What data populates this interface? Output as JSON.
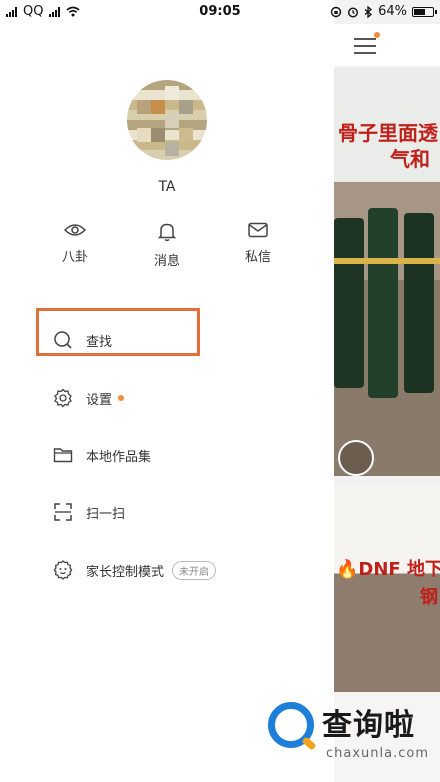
{
  "status_bar": {
    "carrier": "QQ",
    "time": "09:05",
    "battery": "64%",
    "battery_level": 0.64
  },
  "drawer": {
    "username": "TA",
    "actions": [
      {
        "label": "八卦",
        "icon": "eye-icon"
      },
      {
        "label": "消息",
        "icon": "bell-icon"
      },
      {
        "label": "私信",
        "icon": "mail-icon"
      }
    ],
    "menu": {
      "search": {
        "label": "查找",
        "icon": "search-icon"
      },
      "settings": {
        "label": "设置",
        "icon": "gear-icon",
        "has_dot": true
      },
      "local_collection": {
        "label": "本地作品集",
        "icon": "folder-icon"
      },
      "scan": {
        "label": "扫一扫",
        "icon": "scan-icon"
      },
      "parental": {
        "label": "家长控制模式",
        "icon": "child-face-icon",
        "badge": "未开启"
      }
    }
  },
  "feed": {
    "card1_caption_line1": "骨子里面透",
    "card1_caption_line2": "气和",
    "card2_caption_line1": "🔥DNF 地下",
    "card2_caption_line2": "钢"
  },
  "watermark": {
    "title": "查询啦",
    "url": "chaxunla.com"
  },
  "colors": {
    "accent": "#f08c3a",
    "highlight_box": "#e0703a",
    "caption_red": "#c0201a"
  }
}
